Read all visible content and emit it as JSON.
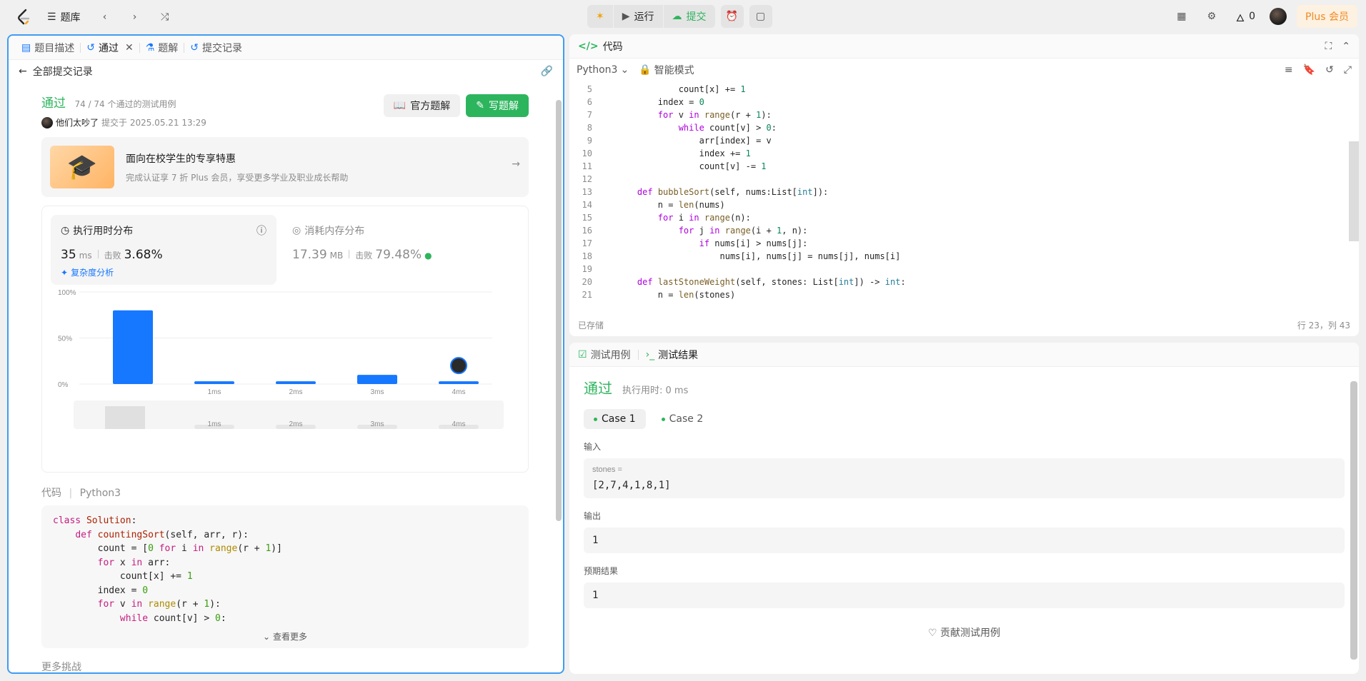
{
  "topbar": {
    "problem_bank": "题库",
    "run": "运行",
    "submit": "提交",
    "streak_count": "0",
    "plus": "Plus 会员"
  },
  "left": {
    "tabs": [
      {
        "label": "题目描述"
      },
      {
        "label": "通过"
      },
      {
        "label": "题解"
      },
      {
        "label": "提交记录"
      }
    ],
    "back": "全部提交记录",
    "status": "通过",
    "status_sub": "74 / 74 个通过的测试用例",
    "user": "他们太吵了",
    "submitted": "提交于 2025.05.21 13:29",
    "official": "官方题解",
    "write": "写题解",
    "promo_title": "面向在校学生的专享特惠",
    "promo_sub": "完成认证享 7 折 Plus 会员，享受更多学业及职业成长帮助",
    "time_card": {
      "title": "执行用时分布",
      "value": "35",
      "unit": "ms",
      "beat_label": "击败",
      "beat": "3.68%",
      "complex": "复杂度分析"
    },
    "mem_card": {
      "title": "消耗内存分布",
      "value": "17.39",
      "unit": "MB",
      "beat_label": "击败",
      "beat": "79.48%"
    },
    "code_label": "代码",
    "code_lang": "Python3",
    "more": "查看更多",
    "challenge": "更多挑战"
  },
  "chart_data": {
    "type": "bar",
    "categories": [
      "",
      "1ms",
      "2ms",
      "3ms",
      "4ms"
    ],
    "values": [
      80,
      3,
      3,
      10,
      3
    ],
    "yticks": [
      "100%",
      "50%",
      "0%"
    ],
    "ylim": [
      0,
      100
    ],
    "highlight_index": 4,
    "color": "#1677ff"
  },
  "codepanel": {
    "title": "代码",
    "lang": "Python3",
    "mode": "智能模式",
    "saved": "已存储",
    "cursor": "行 23，列 43"
  },
  "testpanel": {
    "tab1": "测试用例",
    "tab2": "测试结果",
    "pass": "通过",
    "time": "执行用时: 0 ms",
    "case1": "Case 1",
    "case2": "Case 2",
    "input_label": "输入",
    "var_name": "stones =",
    "input_val": "[2,7,4,1,8,1]",
    "output_label": "输出",
    "output_val": "1",
    "expected_label": "预期结果",
    "expected_val": "1",
    "contribute": "贡献测试用例"
  },
  "colors": {
    "accent": "#2db55d",
    "blue": "#1677ff",
    "plus": "#f08a24"
  }
}
